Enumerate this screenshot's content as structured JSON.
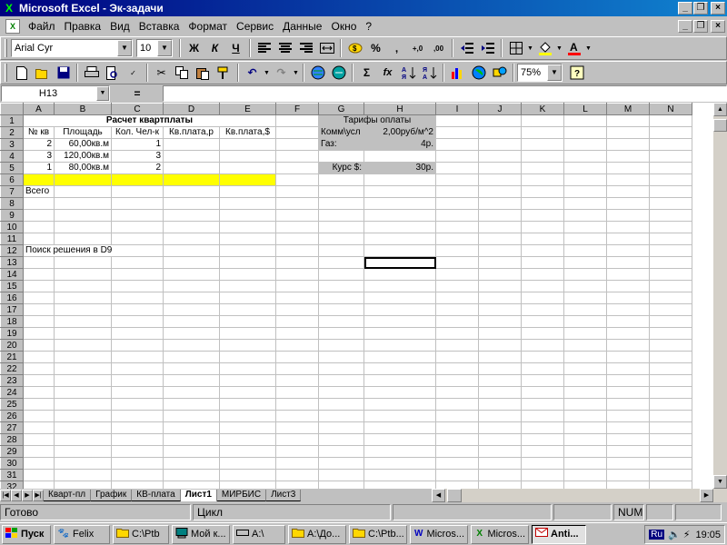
{
  "window": {
    "title": "Microsoft Excel - Эк-задачи",
    "icon": "excel-icon",
    "buttons": [
      "_",
      "❐",
      "×"
    ]
  },
  "menu": {
    "items": [
      "Файл",
      "Правка",
      "Вид",
      "Вставка",
      "Формат",
      "Сервис",
      "Данные",
      "Окно",
      "?"
    ]
  },
  "format_toolbar": {
    "font": "Arial Cyr",
    "size": "10",
    "bold": "Ж",
    "italic": "К",
    "underline": "Ч",
    "percent": "%",
    "comma": ",",
    "inc_decimal": "+,0",
    "dec_decimal": ",00"
  },
  "standard_toolbar": {
    "zoom": "75%",
    "sum": "Σ",
    "fx": "fx"
  },
  "formula_bar": {
    "name_box": "H13",
    "equals": "=",
    "formula": ""
  },
  "columns": [
    "A",
    "B",
    "C",
    "D",
    "E",
    "F",
    "G",
    "H",
    "I",
    "J",
    "K",
    "L",
    "M",
    "N"
  ],
  "rows": [
    "1",
    "2",
    "3",
    "4",
    "5",
    "6",
    "7",
    "8",
    "9",
    "10",
    "11",
    "12",
    "13",
    "14",
    "15",
    "16",
    "17",
    "18",
    "19",
    "20",
    "21",
    "22",
    "23",
    "24",
    "25",
    "26",
    "27",
    "28",
    "29",
    "30",
    "31",
    "32"
  ],
  "cells": {
    "title": "Расчет квартплаты",
    "headers": [
      "№ кв",
      "Площадь",
      "Кол. Чел-к",
      "Кв.плата,р",
      "Кв.плата,$"
    ],
    "data": [
      [
        "2",
        "60,00кв.м",
        "1"
      ],
      [
        "3",
        "120,00кв.м",
        "3"
      ],
      [
        "1",
        "80,00кв.м",
        "2"
      ]
    ],
    "total_label": "Всего",
    "note": "Поиск решения в D9",
    "tariffs_title": "Тарифы оплаты",
    "tariffs": [
      {
        "label": "Комм\\усл",
        "value": "2,00руб/м^2"
      },
      {
        "label": "Газ:",
        "value": "4р."
      }
    ],
    "rate_label": "Курс $:",
    "rate_value": "30р."
  },
  "sheet_tabs": [
    "Кварт-пл",
    "График",
    "КВ-плата",
    "Лист1",
    "МИРБИС",
    "Лист3"
  ],
  "active_tab": "Лист1",
  "status": {
    "ready": "Готово",
    "mode": "Цикл",
    "num": "NUM"
  },
  "taskbar": {
    "start": "Пуск",
    "items": [
      "Felix",
      "C:\\Ptb",
      "Мой к...",
      "A:\\",
      "A:\\До...",
      "C:\\Ptb...",
      "Micros...",
      "Micros...",
      "Anti..."
    ],
    "lang": "Ru",
    "clock": "19:05"
  },
  "colors": {
    "title_start": "#000080",
    "title_end": "#1084d0",
    "highlight_row": "#ffff00",
    "face": "#c0c0c0"
  }
}
